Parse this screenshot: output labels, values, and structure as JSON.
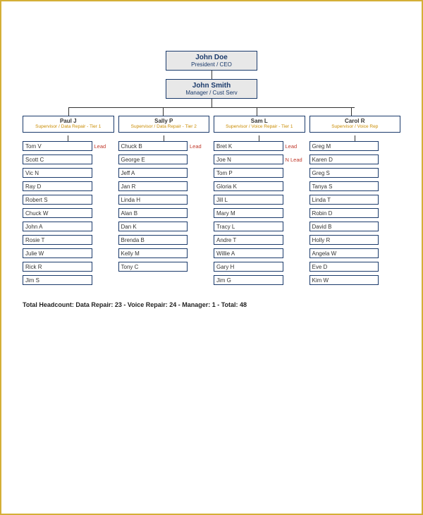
{
  "top": {
    "name": "John Doe",
    "title": "President / CEO"
  },
  "manager": {
    "name": "John Smith",
    "title": "Manager / Cust Serv"
  },
  "columns": [
    {
      "supervisor": {
        "name": "Paul J",
        "title": "Supervisor / Data Repair - Tier 1"
      },
      "members": [
        {
          "name": "Tom V",
          "badge": "Lead"
        },
        {
          "name": "Scott C",
          "badge": ""
        },
        {
          "name": "Vic N",
          "badge": ""
        },
        {
          "name": "Ray D",
          "badge": ""
        },
        {
          "name": "Robert S",
          "badge": ""
        },
        {
          "name": "Chuck W",
          "badge": ""
        },
        {
          "name": "John A",
          "badge": ""
        },
        {
          "name": "Rosie T",
          "badge": ""
        },
        {
          "name": "Julie W",
          "badge": ""
        },
        {
          "name": "Rick R",
          "badge": ""
        },
        {
          "name": "Jim S",
          "badge": ""
        }
      ]
    },
    {
      "supervisor": {
        "name": "Sally P",
        "title": "Supervisor / Data Repair - Tier 2"
      },
      "members": [
        {
          "name": "Chuck B",
          "badge": "Lead"
        },
        {
          "name": "George E",
          "badge": ""
        },
        {
          "name": "Jeff A",
          "badge": ""
        },
        {
          "name": "Jan R",
          "badge": ""
        },
        {
          "name": "Linda H",
          "badge": ""
        },
        {
          "name": "Alan B",
          "badge": ""
        },
        {
          "name": "Dan K",
          "badge": ""
        },
        {
          "name": "Brenda B",
          "badge": ""
        },
        {
          "name": "Kelly M",
          "badge": ""
        },
        {
          "name": "Tony C",
          "badge": ""
        }
      ]
    },
    {
      "supervisor": {
        "name": "Sam L",
        "title": "Supervisor / Voice Repair - Tier 1"
      },
      "members": [
        {
          "name": "Bret K",
          "badge": "Lead"
        },
        {
          "name": "Joe N",
          "badge": "N Lead"
        },
        {
          "name": "Tom P",
          "badge": ""
        },
        {
          "name": "Gloria K",
          "badge": ""
        },
        {
          "name": "Jill L",
          "badge": ""
        },
        {
          "name": "Mary M",
          "badge": ""
        },
        {
          "name": "Tracy L",
          "badge": ""
        },
        {
          "name": "Andre T",
          "badge": ""
        },
        {
          "name": "Willie A",
          "badge": ""
        },
        {
          "name": "Gary H",
          "badge": ""
        },
        {
          "name": "Jim G",
          "badge": ""
        }
      ]
    },
    {
      "supervisor": {
        "name": "Carol R",
        "title": "Supervisor / Voice Rep"
      },
      "members": [
        {
          "name": "Greg M",
          "badge": ""
        },
        {
          "name": "Karen D",
          "badge": ""
        },
        {
          "name": "Greg S",
          "badge": ""
        },
        {
          "name": "Tanya S",
          "badge": ""
        },
        {
          "name": "Linda T",
          "badge": ""
        },
        {
          "name": "Robin D",
          "badge": ""
        },
        {
          "name": "David B",
          "badge": ""
        },
        {
          "name": "Holly R",
          "badge": ""
        },
        {
          "name": "Angela W",
          "badge": ""
        },
        {
          "name": "Eve D",
          "badge": ""
        },
        {
          "name": "Kim W",
          "badge": ""
        }
      ]
    }
  ],
  "footer": "Total Headcount:  Data Repair: 23 -  Voice Repair: 24 -  Manager: 1 -   Total: 48"
}
